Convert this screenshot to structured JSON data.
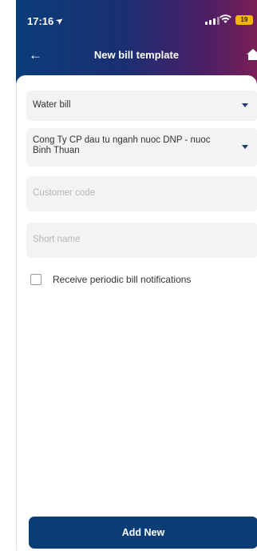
{
  "status_bar": {
    "time": "17:16",
    "battery": "19"
  },
  "nav": {
    "title": "New bill template"
  },
  "form": {
    "bill_type": {
      "value": "Water bill"
    },
    "provider": {
      "value": "Cong Ty CP dau tu nganh nuoc DNP - nuoc Binh Thuan"
    },
    "customer_code": {
      "placeholder": "Customer code",
      "value": ""
    },
    "short_name": {
      "placeholder": "Short name",
      "value": ""
    },
    "notifications_checkbox": {
      "label": "Receive periodic bill notifications",
      "checked": false
    }
  },
  "actions": {
    "add_new_label": "Add New"
  },
  "colors": {
    "header_start": "#0b3c7a",
    "header_end": "#7a1f56",
    "primary_button": "#0a3d75",
    "battery": "#f5b400"
  },
  "icons": {
    "back": "arrow-left-icon",
    "home": "home-icon",
    "dropdown": "caret-down-icon",
    "location": "location-arrow-icon",
    "signal": "signal-icon",
    "wifi": "wifi-icon",
    "battery": "battery-icon"
  }
}
